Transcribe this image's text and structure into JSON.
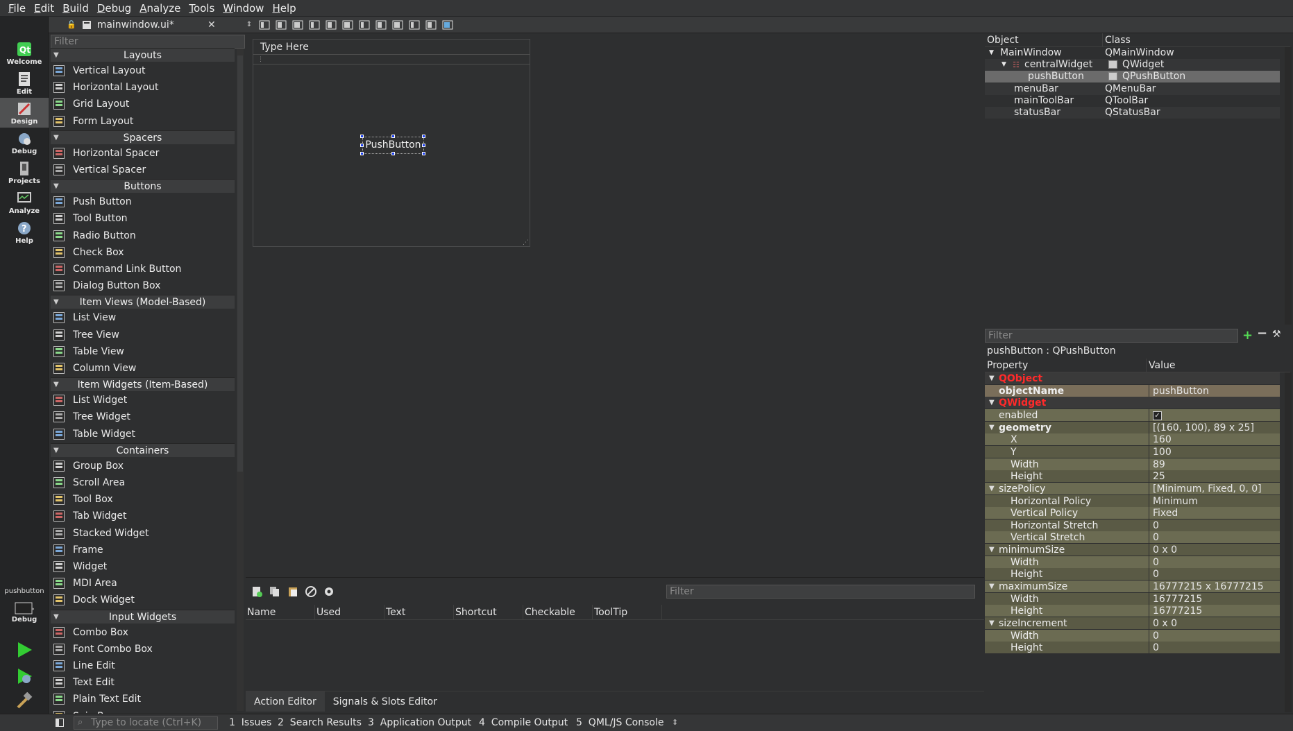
{
  "menu": [
    "File",
    "Edit",
    "Build",
    "Debug",
    "Analyze",
    "Tools",
    "Window",
    "Help"
  ],
  "modes": [
    {
      "label": "Welcome",
      "icon": "qt-logo-icon"
    },
    {
      "label": "Edit",
      "icon": "document-icon"
    },
    {
      "label": "Design",
      "icon": "pen-icon"
    },
    {
      "label": "Debug",
      "icon": "bug-icon"
    },
    {
      "label": "Projects",
      "icon": "wrench-icon"
    },
    {
      "label": "Analyze",
      "icon": "monitor-icon"
    },
    {
      "label": "Help",
      "icon": "help-icon"
    }
  ],
  "target": {
    "label": "pushbutton",
    "mode": "Debug"
  },
  "file": {
    "name": "mainwindow.ui*"
  },
  "widgetbox": {
    "filter_placeholder": "Filter",
    "categories": [
      {
        "name": "Layouts",
        "items": [
          "Vertical Layout",
          "Horizontal Layout",
          "Grid Layout",
          "Form Layout"
        ]
      },
      {
        "name": "Spacers",
        "items": [
          "Horizontal Spacer",
          "Vertical Spacer"
        ]
      },
      {
        "name": "Buttons",
        "items": [
          "Push Button",
          "Tool Button",
          "Radio Button",
          "Check Box",
          "Command Link Button",
          "Dialog Button Box"
        ]
      },
      {
        "name": "Item Views (Model-Based)",
        "items": [
          "List View",
          "Tree View",
          "Table View",
          "Column View"
        ]
      },
      {
        "name": "Item Widgets (Item-Based)",
        "items": [
          "List Widget",
          "Tree Widget",
          "Table Widget"
        ]
      },
      {
        "name": "Containers",
        "items": [
          "Group Box",
          "Scroll Area",
          "Tool Box",
          "Tab Widget",
          "Stacked Widget",
          "Frame",
          "Widget",
          "MDI Area",
          "Dock Widget"
        ]
      },
      {
        "name": "Input Widgets",
        "items": [
          "Combo Box",
          "Font Combo Box",
          "Line Edit",
          "Text Edit",
          "Plain Text Edit",
          "Spin Box"
        ]
      }
    ]
  },
  "form": {
    "menu_placeholder": "Type Here",
    "button_label": "PushButton"
  },
  "action_editor": {
    "filter_placeholder": "Filter",
    "columns": [
      "Name",
      "Used",
      "Text",
      "Shortcut",
      "Checkable",
      "ToolTip"
    ],
    "tabs": [
      "Action Editor",
      "Signals & Slots Editor"
    ]
  },
  "object_inspector": {
    "columns": [
      "Object",
      "Class"
    ],
    "rows": [
      {
        "object": "MainWindow",
        "class": "QMainWindow",
        "depth": 0
      },
      {
        "object": "centralWidget",
        "class": "QWidget",
        "depth": 1
      },
      {
        "object": "pushButton",
        "class": "QPushButton",
        "depth": 2
      },
      {
        "object": "menuBar",
        "class": "QMenuBar",
        "depth": 1
      },
      {
        "object": "mainToolBar",
        "class": "QToolBar",
        "depth": 1
      },
      {
        "object": "statusBar",
        "class": "QStatusBar",
        "depth": 1
      }
    ]
  },
  "property_editor": {
    "filter_placeholder": "Filter",
    "selection": "pushButton : QPushButton",
    "columns": [
      "Property",
      "Value"
    ],
    "rows": [
      {
        "name": "QObject",
        "value": "",
        "kind": "group"
      },
      {
        "name": "objectName",
        "value": "pushButton",
        "kind": "bold"
      },
      {
        "name": "QWidget",
        "value": "",
        "kind": "group"
      },
      {
        "name": "enabled",
        "value": "✓",
        "kind": "plain"
      },
      {
        "name": "geometry",
        "value": "[(160, 100), 89 x 25]",
        "kind": "bold-expand"
      },
      {
        "name": "X",
        "value": "160",
        "kind": "sub"
      },
      {
        "name": "Y",
        "value": "100",
        "kind": "sub"
      },
      {
        "name": "Width",
        "value": "89",
        "kind": "sub"
      },
      {
        "name": "Height",
        "value": "25",
        "kind": "sub"
      },
      {
        "name": "sizePolicy",
        "value": "[Minimum, Fixed, 0, 0]",
        "kind": "expand"
      },
      {
        "name": "Horizontal Policy",
        "value": "Minimum",
        "kind": "sub"
      },
      {
        "name": "Vertical Policy",
        "value": "Fixed",
        "kind": "sub"
      },
      {
        "name": "Horizontal Stretch",
        "value": "0",
        "kind": "sub"
      },
      {
        "name": "Vertical Stretch",
        "value": "0",
        "kind": "sub"
      },
      {
        "name": "minimumSize",
        "value": "0 x 0",
        "kind": "expand"
      },
      {
        "name": "Width",
        "value": "0",
        "kind": "sub"
      },
      {
        "name": "Height",
        "value": "0",
        "kind": "sub"
      },
      {
        "name": "maximumSize",
        "value": "16777215 x 16777215",
        "kind": "expand"
      },
      {
        "name": "Width",
        "value": "16777215",
        "kind": "sub"
      },
      {
        "name": "Height",
        "value": "16777215",
        "kind": "sub"
      },
      {
        "name": "sizeIncrement",
        "value": "0 x 0",
        "kind": "expand"
      },
      {
        "name": "Width",
        "value": "0",
        "kind": "sub"
      },
      {
        "name": "Height",
        "value": "0",
        "kind": "sub"
      }
    ]
  },
  "statusbar": {
    "locate_placeholder": "Type to locate (Ctrl+K)",
    "tabs": [
      "1  Issues",
      "2  Search Results",
      "3  Application Output",
      "4  Compile Output",
      "5  QML/JS Console"
    ]
  },
  "colors": {
    "group_red": "#ff2a2a",
    "prop_row": "#5a5a45",
    "prop_row_alt": "#6b6b52",
    "prop_bold_row": "#7a6e5a",
    "selection": "#6b6b6b",
    "handle": "#1a3df0"
  }
}
